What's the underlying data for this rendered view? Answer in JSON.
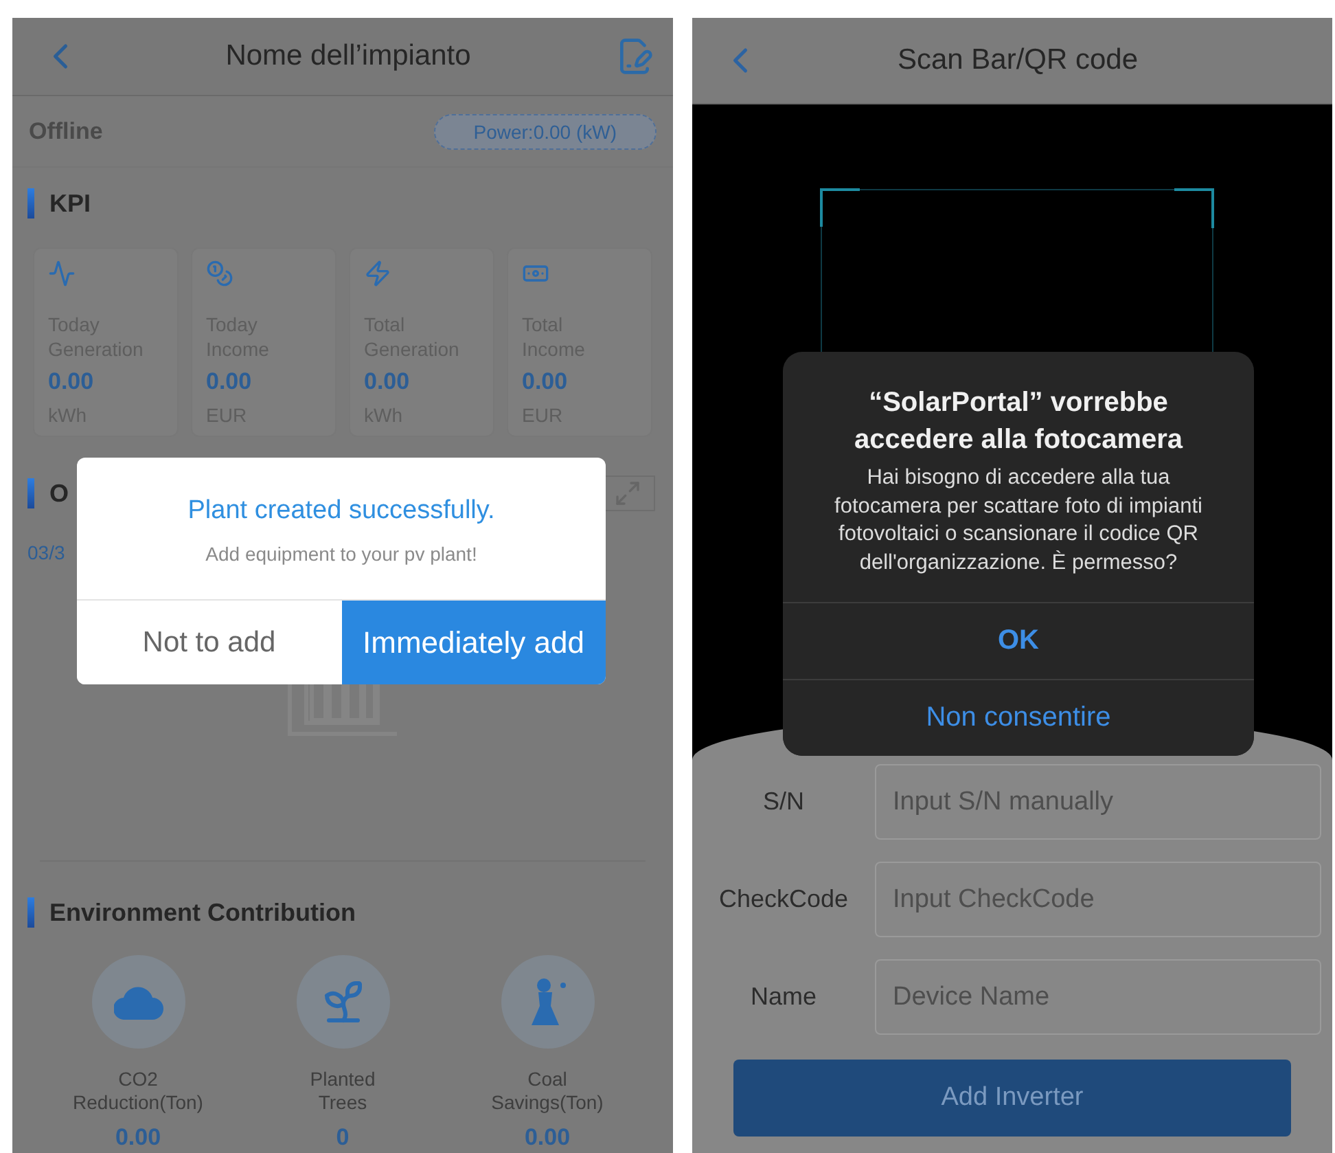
{
  "plant_screen": {
    "title": "Nome dell’impianto",
    "status": "Offline",
    "power": "Power:0.00 (kW)",
    "kpi": {
      "title": "KPI",
      "cards": [
        {
          "label": "Today Generation",
          "value": "0.00",
          "unit": "kWh"
        },
        {
          "label": "Today Income",
          "value": "0.00",
          "unit": "EUR"
        },
        {
          "label": "Total Generation",
          "value": "0.00",
          "unit": "kWh"
        },
        {
          "label": "Total Income",
          "value": "0.00",
          "unit": "EUR"
        }
      ]
    },
    "overview": {
      "title": "O",
      "date": "03/3"
    },
    "environment": {
      "title": "Environment Contribution",
      "items": [
        {
          "label": "CO2 Reduction(Ton)",
          "value": "0.00"
        },
        {
          "label": "Planted Trees",
          "value": "0"
        },
        {
          "label": "Coal Savings(Ton)",
          "value": "0.00"
        }
      ]
    },
    "dialog": {
      "title": "Plant created successfully.",
      "message": "Add equipment to your pv plant!",
      "buttons": [
        {
          "label": "Not to add",
          "kind": "secondary"
        },
        {
          "label": "Immediately add",
          "kind": "primary"
        }
      ]
    }
  },
  "scan_screen": {
    "title": "Scan Bar/QR code",
    "fields": [
      {
        "label": "S/N",
        "placeholder": "Input S/N manually"
      },
      {
        "label": "CheckCode",
        "placeholder": "Input CheckCode"
      },
      {
        "label": "Name",
        "placeholder": "Device Name"
      }
    ],
    "submit": "Add Inverter",
    "alert": {
      "title": "“SolarPortal” vorrebbe accedere alla fotocamera",
      "message": "Hai bisogno di accedere alla tua fotocamera per scattare foto di impianti fotovoltaici o scansionare il codice QR dell'organizzazione. È permesso?",
      "buttons": [
        {
          "label": "OK",
          "kind": "preferred"
        },
        {
          "label": "Non consentire",
          "kind": "default"
        }
      ]
    }
  }
}
